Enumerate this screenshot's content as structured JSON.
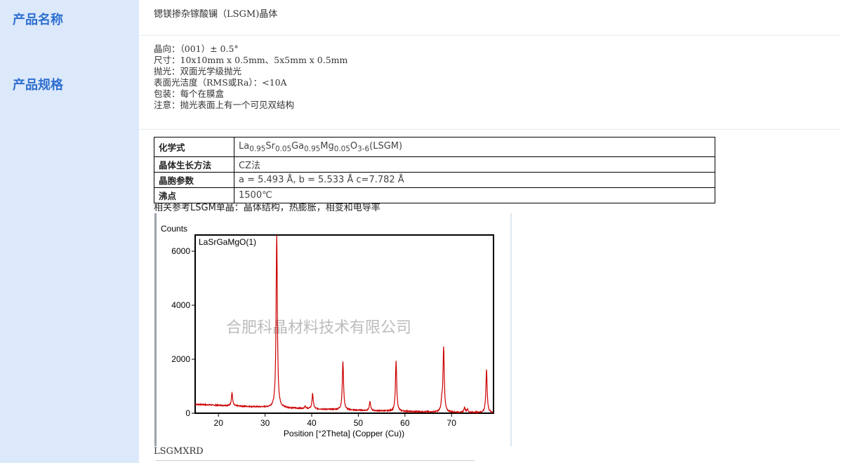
{
  "sidebar": {
    "product_name_label": "产品名称",
    "product_spec_label": "产品规格"
  },
  "product_name": "锶镁掺杂镓酸镧（LSGM)晶体",
  "specs": [
    "晶向：（001）± 0.5°",
    "尺寸：10x10mm x 0.5mm、5x5mm x 0.5mm",
    "抛光：双面光学级抛光",
    "表面光洁度（RMS或Ra）：<10A",
    "包装：每个在膜盒",
    "注意：抛光表面上有一个可见双结构"
  ],
  "properties": [
    {
      "key": "化学式",
      "formula": [
        {
          "t": "La"
        },
        {
          "t": "0.95",
          "sub": true
        },
        {
          "t": "Sr"
        },
        {
          "t": "0.05",
          "sub": true
        },
        {
          "t": "Ga"
        },
        {
          "t": "0.95",
          "sub": true
        },
        {
          "t": "Mg"
        },
        {
          "t": "0.05",
          "sub": true
        },
        {
          "t": "O"
        },
        {
          "t": "3-6",
          "sub": true
        },
        {
          "t": "(LSGM)"
        }
      ]
    },
    {
      "key": "晶体生长方法",
      "value": "CZ法"
    },
    {
      "key": "晶胞参数",
      "value": "a = 5.493 Å, b = 5.533 Å  c=7.782 Å"
    },
    {
      "key": "沸点",
      "value": "1500℃"
    }
  ],
  "reference_text": "相关参考LSGM单晶：晶体结构，热膨胀，相变和电导率",
  "chart_data": {
    "type": "line",
    "title": "LaSrGaMgO(1)",
    "ylabel": "Counts",
    "xlabel": "Position [°2Theta] (Copper (Cu))",
    "xlim": [
      15,
      79
    ],
    "ylim": [
      0,
      6600
    ],
    "xticks": [
      20,
      30,
      40,
      50,
      60,
      70
    ],
    "yticks": [
      0,
      2000,
      4000,
      6000
    ],
    "line_color": "#cc0000",
    "watermark": "合肥科晶材料技术有限公司",
    "peaks": [
      {
        "x": 22.9,
        "y": 480
      },
      {
        "x": 32.5,
        "y": 6500
      },
      {
        "x": 38.6,
        "y": 100
      },
      {
        "x": 40.2,
        "y": 560
      },
      {
        "x": 46.7,
        "y": 1800
      },
      {
        "x": 52.5,
        "y": 330
      },
      {
        "x": 58.1,
        "y": 1850
      },
      {
        "x": 67.9,
        "y": 350
      },
      {
        "x": 68.3,
        "y": 2400
      },
      {
        "x": 72.8,
        "y": 190
      },
      {
        "x": 73.4,
        "y": 120
      },
      {
        "x": 77.5,
        "y": 1600
      }
    ],
    "background": {
      "start": 310,
      "end": 20
    }
  },
  "caption": "LSGMXRD"
}
